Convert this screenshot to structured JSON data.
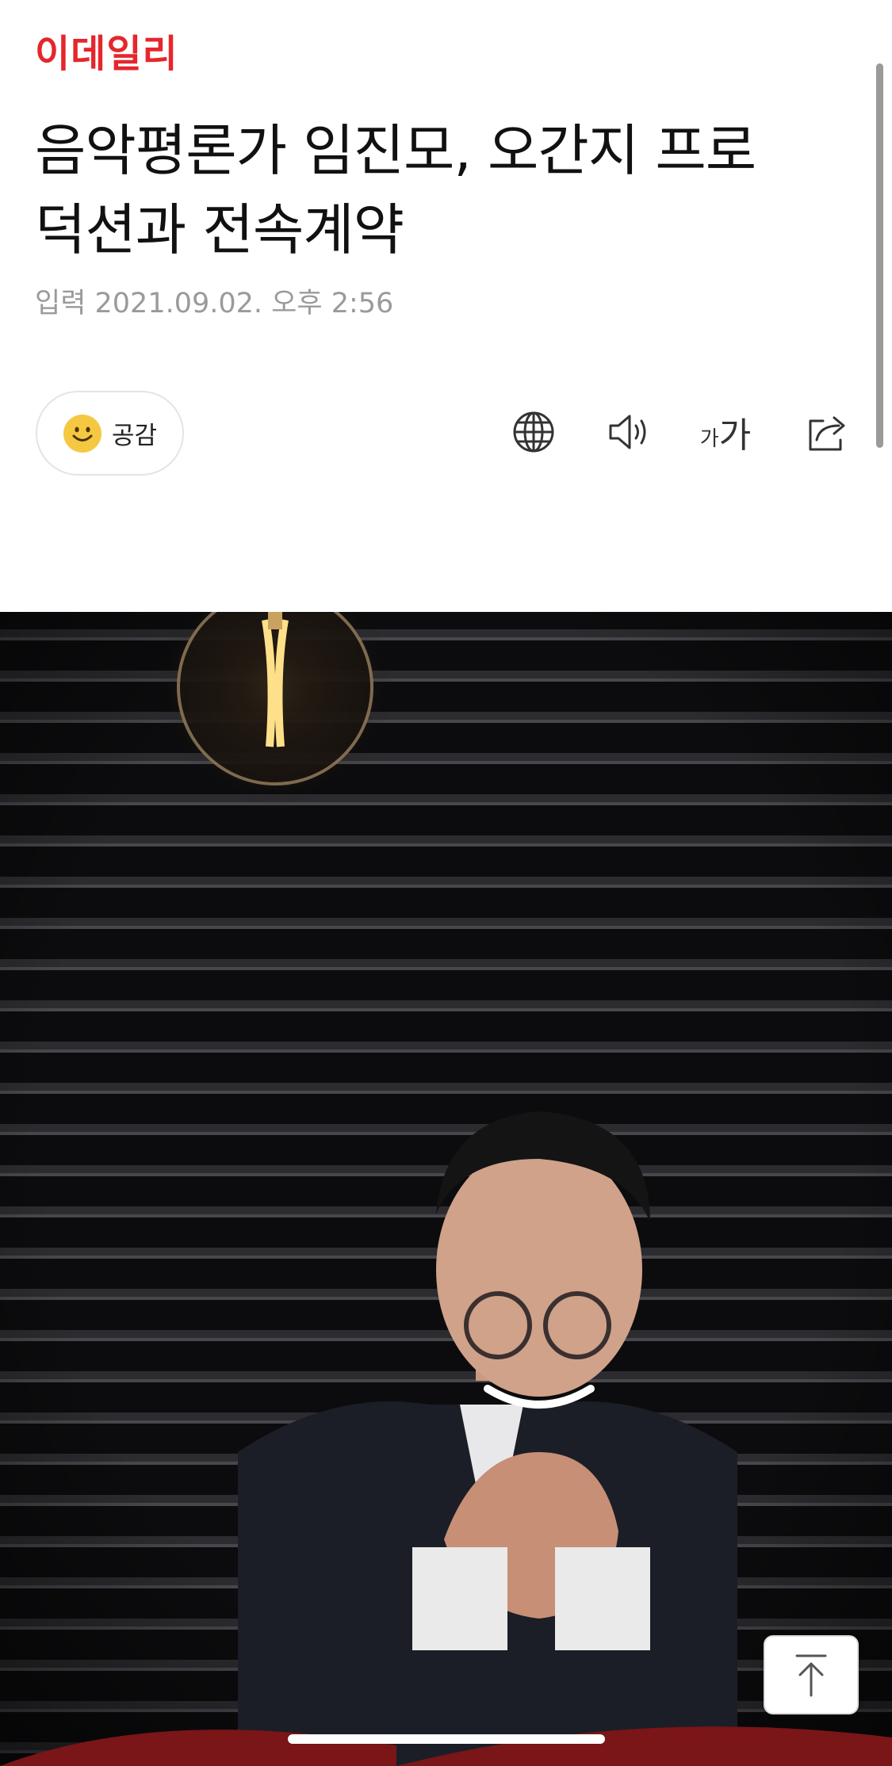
{
  "brand": {
    "logo_text": "이데일리",
    "color": "#e5262c"
  },
  "article": {
    "headline_line1": "음악평론가 임진모, 오간지 프로",
    "headline_line2": "덕션과 전속계약",
    "published": "입력 2021.09.02. 오후 2:56"
  },
  "actions": {
    "like_label": "공감",
    "translate_icon": "globe-icon",
    "speech_icon": "speaker-icon",
    "font_small": "가",
    "font_big": "가",
    "share_icon": "share-icon"
  },
  "photo": {
    "description_icon": "article-photo"
  },
  "scroll_top_icon": "arrow-up-to-top-icon",
  "colors": {
    "meta_text": "#9a9a9a",
    "smiley": "#f5c842",
    "photo_background": "#0e0e10"
  }
}
